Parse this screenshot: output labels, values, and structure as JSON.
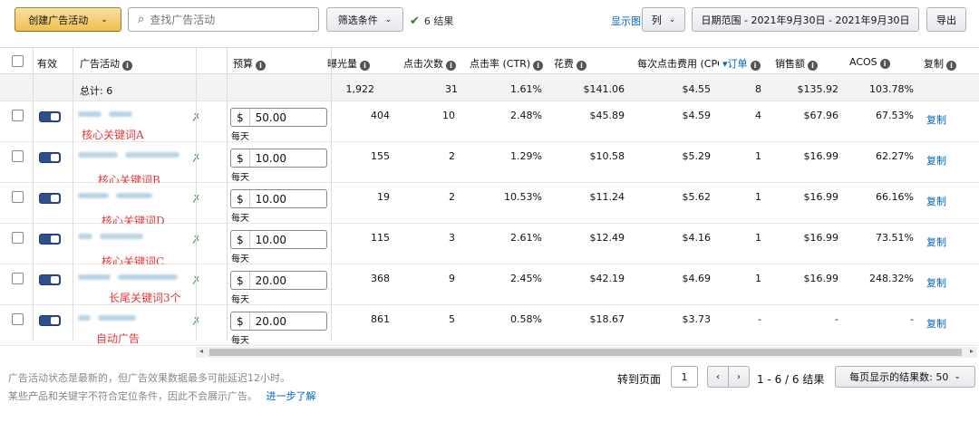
{
  "toolbar": {
    "create_label": "创建广告活动",
    "search_placeholder": "查找广告活动",
    "filter_label": "筛选条件",
    "result_label": "6 结果",
    "show_chart": "显示图表",
    "columns_label": "列",
    "date_range": "日期范围 - 2021年9月30日 - 2021年9月30日",
    "export_label": "导出"
  },
  "columns": {
    "active": "有效",
    "campaign": "广告活动",
    "budget": "预算",
    "impressions": "曝光量",
    "clicks": "点击次数",
    "ctr": "点击率 (CTR)",
    "spend": "花费",
    "cpc": "每次点击费用 (CPC",
    "orders": "订单",
    "sales": "销售额",
    "acos": "ACOS",
    "copy": "复制"
  },
  "totals": {
    "label": "总计: 6",
    "impressions": "1,922",
    "clicks": "31",
    "ctr": "1.61%",
    "spend": "$141.06",
    "cpc": "$4.55",
    "orders": "8",
    "sales": "$135.92",
    "acos": "103.78%"
  },
  "rows": [
    {
      "note": "核心关键词A",
      "currency": "$",
      "budget": "50.00",
      "per_day": "每天",
      "impressions": "404",
      "clicks": "10",
      "ctr": "2.48%",
      "spend": "$45.89",
      "cpc": "$4.59",
      "orders": "4",
      "sales": "$67.96",
      "acos": "67.53%",
      "copy": "复制"
    },
    {
      "note": "核心关键词B",
      "currency": "$",
      "budget": "10.00",
      "per_day": "每天",
      "impressions": "155",
      "clicks": "2",
      "ctr": "1.29%",
      "spend": "$10.58",
      "cpc": "$5.29",
      "orders": "1",
      "sales": "$16.99",
      "acos": "62.27%",
      "copy": "复制"
    },
    {
      "note": "核心关键词D",
      "currency": "$",
      "budget": "10.00",
      "per_day": "每天",
      "impressions": "19",
      "clicks": "2",
      "ctr": "10.53%",
      "spend": "$11.24",
      "cpc": "$5.62",
      "orders": "1",
      "sales": "$16.99",
      "acos": "66.16%",
      "copy": "复制"
    },
    {
      "note": "核心关键词C",
      "currency": "$",
      "budget": "10.00",
      "per_day": "每天",
      "impressions": "115",
      "clicks": "3",
      "ctr": "2.61%",
      "spend": "$12.49",
      "cpc": "$4.16",
      "orders": "1",
      "sales": "$16.99",
      "acos": "73.51%",
      "copy": "复制"
    },
    {
      "note": "长尾关键词3个",
      "currency": "$",
      "budget": "20.00",
      "per_day": "每天",
      "impressions": "368",
      "clicks": "9",
      "ctr": "2.45%",
      "spend": "$42.19",
      "cpc": "$4.69",
      "orders": "1",
      "sales": "$16.99",
      "acos": "248.32%",
      "copy": "复制"
    },
    {
      "note": "自动广告",
      "currency": "$",
      "budget": "20.00",
      "per_day": "每天",
      "impressions": "861",
      "clicks": "5",
      "ctr": "0.58%",
      "spend": "$18.67",
      "cpc": "$3.73",
      "orders": "-",
      "sales": "-",
      "acos": "-",
      "copy": "复制"
    }
  ],
  "footer": {
    "line1": "广告活动状态是最新的，但广告效果数据最多可能延迟12小时。",
    "line2": "某些产品和关键字不符合定位条件，因此不会展示广告。",
    "learn_more": "进一步了解",
    "goto_page": "转到页面",
    "page_value": "1",
    "range": "1 - 6 / 6 结果",
    "per_page": "每页显示的结果数: 50"
  },
  "colors": {
    "accent": "#f0c14b",
    "link": "#0066c0",
    "toggle": "#2d4f8c",
    "note": "#e5393c"
  }
}
